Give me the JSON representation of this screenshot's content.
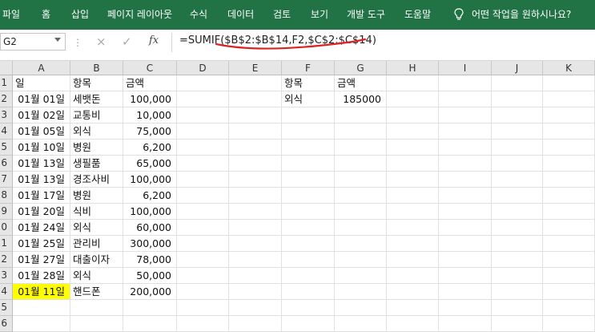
{
  "ribbon": {
    "tabs": [
      "파일",
      "홈",
      "삽입",
      "페이지 레이아웃",
      "수식",
      "데이터",
      "검토",
      "보기",
      "개발 도구",
      "도움말"
    ],
    "search_text": "어떤 작업을 원하시나요?",
    "bg_color": "#217346"
  },
  "formula_bar": {
    "name_box": "G2",
    "fx_label": "fx",
    "formula": "=SUMIF($B$2:$B$14,F2,$C$2:$C$14)",
    "cancel_icon": "×",
    "enter_icon": "✓"
  },
  "columns": [
    "A",
    "B",
    "C",
    "D",
    "E",
    "F",
    "G",
    "H",
    "I",
    "J",
    "K"
  ],
  "rows": [
    "1",
    "2",
    "3",
    "4",
    "5",
    "6",
    "7",
    "8",
    "9",
    "0",
    "1",
    "2",
    "3",
    "4",
    "5",
    "6"
  ],
  "table": {
    "header": [
      "일",
      "항목",
      "금액"
    ],
    "data": [
      [
        "01월 01일",
        "세뱃돈",
        "100,000"
      ],
      [
        "01월 02일",
        "교통비",
        "10,000"
      ],
      [
        "01월 05일",
        "외식",
        "75,000"
      ],
      [
        "01월 10일",
        "병원",
        "6,200"
      ],
      [
        "01월 13일",
        "생필품",
        "65,000"
      ],
      [
        "01월 13일",
        "경조사비",
        "100,000"
      ],
      [
        "01월 17일",
        "병원",
        "6,200"
      ],
      [
        "01월 20일",
        "식비",
        "100,000"
      ],
      [
        "01월 24일",
        "외식",
        "60,000"
      ],
      [
        "01월 25일",
        "관리비",
        "300,000"
      ],
      [
        "01월 27일",
        "대출이자",
        "78,000"
      ],
      [
        "01월 28일",
        "외식",
        "50,000"
      ],
      [
        "01월 11일",
        "핸드폰",
        "200,000"
      ]
    ],
    "highlight_color": "#ffff00"
  },
  "summary": {
    "header": [
      "항목",
      "금액"
    ],
    "item": "외식",
    "total": "185000"
  }
}
